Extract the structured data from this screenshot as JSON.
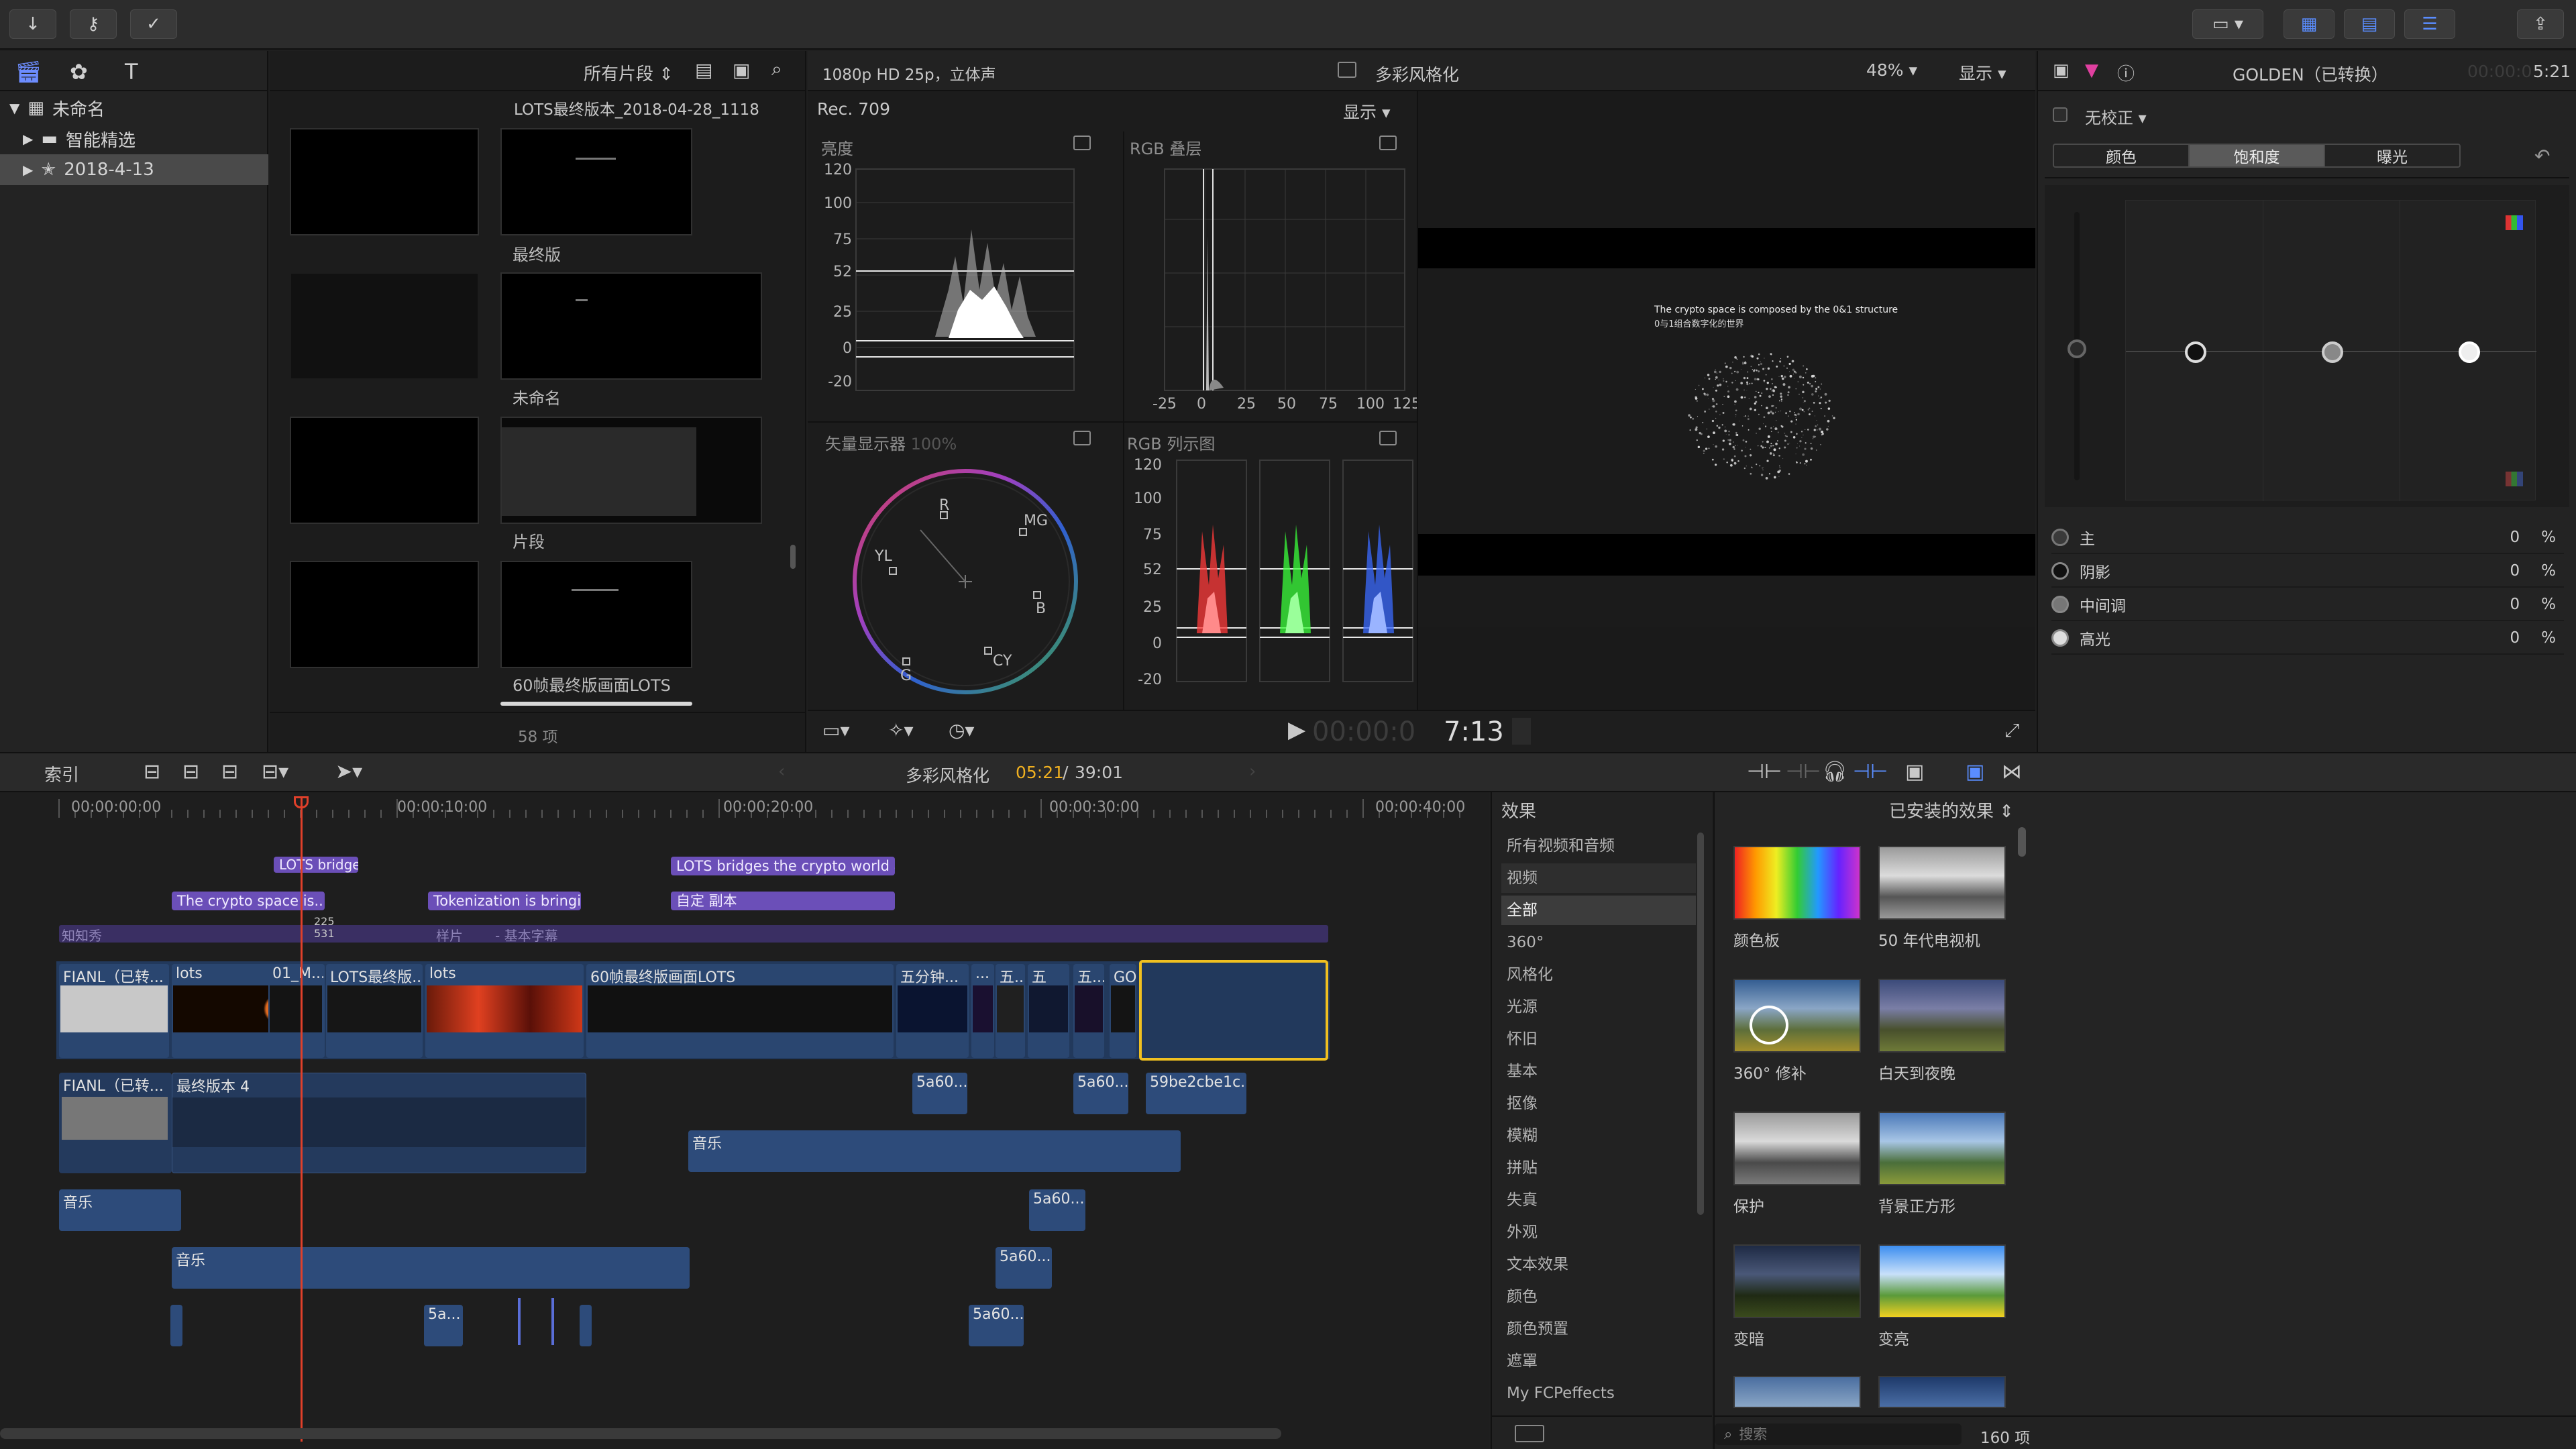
{
  "toolbar": {
    "icons": [
      "import-icon",
      "key-icon",
      "checkmark-icon",
      "workspace-icon",
      "browser-layout-icon",
      "timeline-layout-icon",
      "inspector-layout-icon",
      "share-icon"
    ]
  },
  "library": {
    "items": [
      {
        "label": "未命名",
        "expanded": true
      },
      {
        "label": "智能精选",
        "expanded": false
      },
      {
        "label": "2018-4-13",
        "expanded": false,
        "selected": true
      }
    ]
  },
  "browser": {
    "filter_label": "所有片段",
    "count": "58 项",
    "header_clip": "LOTS最终版本_2018-04-28_1118",
    "clips": [
      {
        "name": "最终版"
      },
      {
        "name": "未命名"
      },
      {
        "name": "片段"
      },
      {
        "name": "60帧最终版画面LOTS"
      }
    ]
  },
  "viewer_header": {
    "format": "1080p HD 25p，立体声",
    "project": "多彩风格化",
    "zoom": "48%",
    "view_label": "显示"
  },
  "scopes": {
    "colorspace": "Rec. 709",
    "display_label": "显示",
    "luma": {
      "title": "亮度",
      "ticks": [
        "120",
        "100",
        "75",
        "52",
        "25",
        "0",
        "-20"
      ]
    },
    "rgb_overlay": {
      "title": "RGB 叠层",
      "xticks": [
        "-25",
        "0",
        "25",
        "50",
        "75",
        "100",
        "125"
      ]
    },
    "vectorscope": {
      "title": "矢量显示器",
      "percent": "100%",
      "labels": [
        "R",
        "MG",
        "B",
        "CY",
        "G",
        "YL"
      ]
    },
    "rgb_parade": {
      "title": "RGB 列示图",
      "ticks": [
        "120",
        "100",
        "75",
        "52",
        "25",
        "0",
        "-20"
      ],
      "channels": [
        "红色",
        "绿色",
        "蓝色"
      ]
    }
  },
  "viewer": {
    "overlay_line1": "The crypto space is composed by the 0&1 structure",
    "overlay_line2": "0与1组合数字化的世界",
    "timecode_dim": "00:00:0",
    "timecode": "7:13"
  },
  "inspector": {
    "clip_title": "GOLDEN（已转换）",
    "time_dim": "00:00:0",
    "time": "5:21",
    "correction": "无校正",
    "tabs": [
      "颜色",
      "饱和度",
      "曝光"
    ],
    "active_tab": 1,
    "rows": [
      {
        "label": "主",
        "value": "0",
        "unit": "%"
      },
      {
        "label": "阴影",
        "value": "0",
        "unit": "%"
      },
      {
        "label": "中间调",
        "value": "0",
        "unit": "%"
      },
      {
        "label": "高光",
        "value": "0",
        "unit": "%"
      }
    ]
  },
  "timeline_bar": {
    "index_label": "索引",
    "project": "多彩风格化",
    "position": "05:21",
    "duration": "39:01",
    "separator": " / "
  },
  "timeline": {
    "ruler": [
      "00:00:00:00",
      "00:00:10:00",
      "00:00:20:00",
      "00:00:30:00",
      "00:00:40:00"
    ],
    "playhead_readout": [
      "225",
      "531"
    ],
    "titles": [
      {
        "label": "The crypto space is..."
      },
      {
        "label": "Tokenization is bringi..."
      },
      {
        "label": "LOTS bridges the crypto world a..."
      },
      {
        "label": "自定 副本"
      }
    ],
    "lane_labels": [
      "知知秀",
      "样片",
      "- 基本字幕"
    ],
    "primary_clips": [
      "FIANL（已转...",
      "lots",
      "01_M...",
      "LOTS最终版...",
      "lots",
      "60帧最终版画面LOTS",
      "五分钟...",
      "...",
      "五...",
      "五",
      "五...",
      "GOLDEN（已转换）"
    ],
    "connected": [
      "FIANL（已转...",
      "最终版本 4",
      "5a60...",
      "5a60...",
      "59be2cbe1c...",
      "音乐",
      "音乐",
      "5a60...",
      "音乐",
      "5a60...",
      "5a...",
      "5a60..."
    ]
  },
  "effects": {
    "header": "效果",
    "installed": "已安装的效果",
    "categories": [
      "所有视频和音频",
      "视频",
      "全部",
      "360°",
      "风格化",
      "光源",
      "怀旧",
      "基本",
      "抠像",
      "模糊",
      "拼贴",
      "失真",
      "外观",
      "文本效果",
      "颜色",
      "颜色预置",
      "遮罩",
      "My FCPeffects"
    ],
    "selected_category": 2,
    "thumbs": [
      {
        "label": "颜色板"
      },
      {
        "label": "50 年代电视机"
      },
      {
        "label": "360° 修补"
      },
      {
        "label": "白天到夜晚"
      },
      {
        "label": "保护"
      },
      {
        "label": "背景正方形"
      },
      {
        "label": "变暗"
      },
      {
        "label": "变亮"
      }
    ],
    "search_placeholder": "搜索",
    "count": "160 项"
  }
}
